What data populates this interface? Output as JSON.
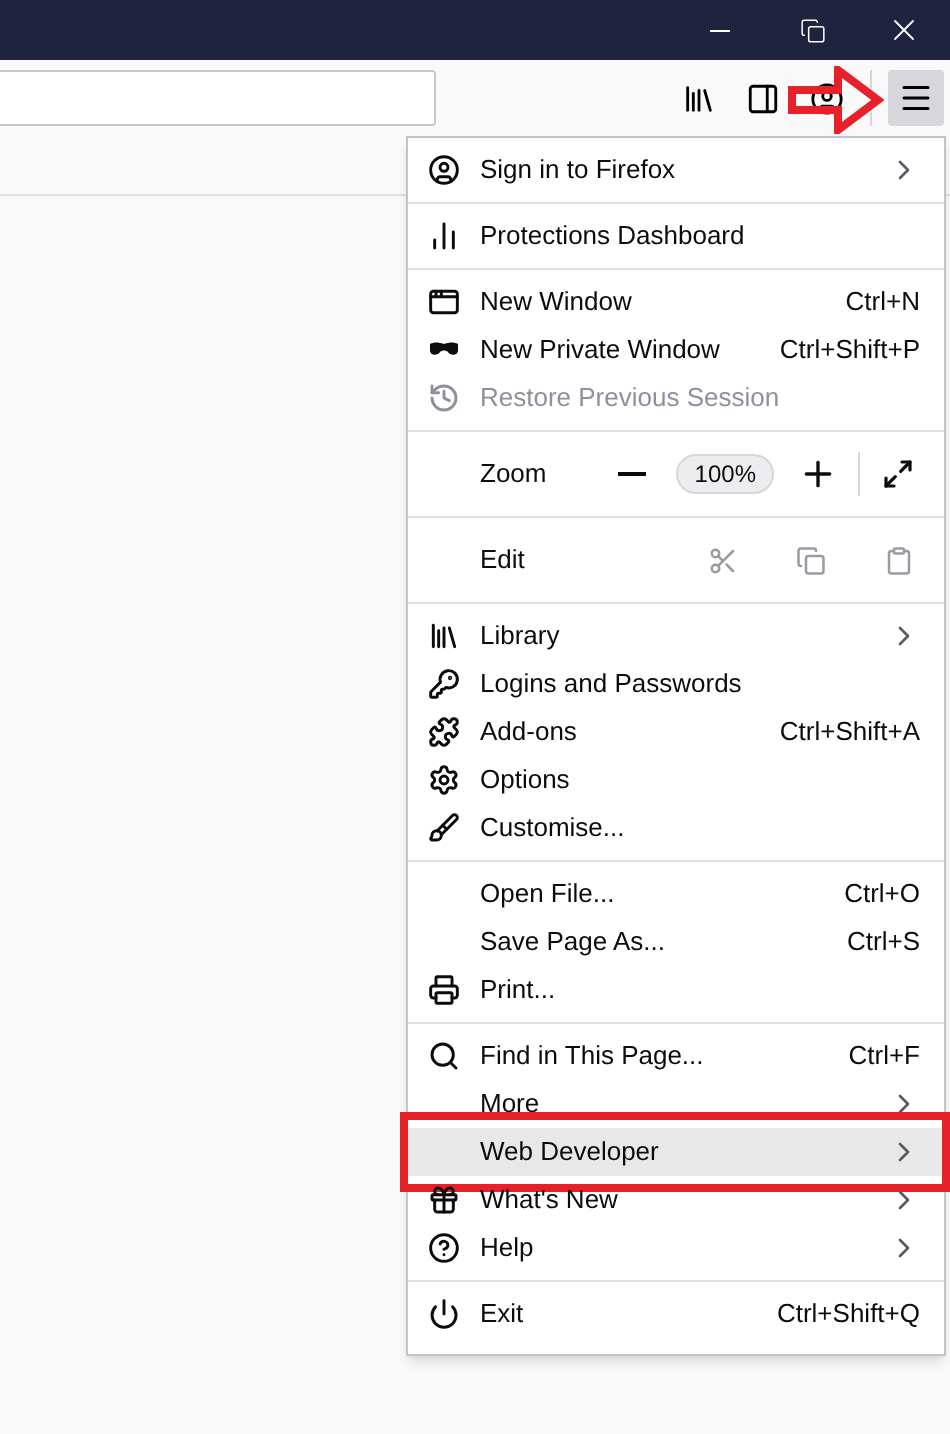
{
  "menu": {
    "sections": [
      {
        "items": [
          {
            "kind": "item",
            "label": "Sign in to Firefox",
            "submenu": true,
            "disabled": false,
            "selected": false
          }
        ]
      },
      {
        "items": [
          {
            "kind": "item",
            "label": "Protections Dashboard",
            "submenu": false,
            "disabled": false,
            "selected": false
          }
        ]
      },
      {
        "items": [
          {
            "kind": "item",
            "label": "New Window",
            "shortcut": "Ctrl+N",
            "submenu": false,
            "disabled": false,
            "selected": false
          },
          {
            "kind": "item",
            "label": "New Private Window",
            "shortcut": "Ctrl+Shift+P",
            "submenu": false,
            "disabled": false,
            "selected": false
          },
          {
            "kind": "item",
            "label": "Restore Previous Session",
            "submenu": false,
            "disabled": true,
            "selected": false
          }
        ]
      },
      {
        "items": [
          {
            "kind": "zoom",
            "label": "Zoom",
            "value": "100%"
          }
        ]
      },
      {
        "items": [
          {
            "kind": "edit",
            "label": "Edit",
            "tools_disabled": true
          }
        ]
      },
      {
        "items": [
          {
            "kind": "item",
            "label": "Library",
            "submenu": true,
            "disabled": false,
            "selected": false
          },
          {
            "kind": "item",
            "label": "Logins and Passwords",
            "submenu": false,
            "disabled": false,
            "selected": false
          },
          {
            "kind": "item",
            "label": "Add-ons",
            "shortcut": "Ctrl+Shift+A",
            "submenu": false,
            "disabled": false,
            "selected": false
          },
          {
            "kind": "item",
            "label": "Options",
            "submenu": false,
            "disabled": false,
            "selected": false
          },
          {
            "kind": "item",
            "label": "Customise...",
            "submenu": false,
            "disabled": false,
            "selected": false
          }
        ]
      },
      {
        "items": [
          {
            "kind": "item",
            "label": "Open File...",
            "shortcut": "Ctrl+O",
            "submenu": false,
            "disabled": false,
            "selected": false
          },
          {
            "kind": "item",
            "label": "Save Page As...",
            "shortcut": "Ctrl+S",
            "submenu": false,
            "disabled": false,
            "selected": false
          },
          {
            "kind": "item",
            "label": "Print...",
            "submenu": false,
            "disabled": false,
            "selected": false
          }
        ]
      },
      {
        "items": [
          {
            "kind": "item",
            "label": "Find in This Page...",
            "shortcut": "Ctrl+F",
            "submenu": false,
            "disabled": false,
            "selected": false
          },
          {
            "kind": "item",
            "label": "More",
            "submenu": true,
            "disabled": false,
            "selected": false
          },
          {
            "kind": "item",
            "label": "Web Developer",
            "submenu": true,
            "disabled": false,
            "selected": true
          },
          {
            "kind": "item",
            "label": "What's New",
            "submenu": true,
            "disabled": false,
            "selected": false
          },
          {
            "kind": "item",
            "label": "Help",
            "submenu": true,
            "disabled": false,
            "selected": false
          }
        ]
      },
      {
        "items": [
          {
            "kind": "item",
            "label": "Exit",
            "shortcut": "Ctrl+Shift+Q",
            "submenu": false,
            "disabled": false,
            "selected": false
          }
        ]
      }
    ]
  }
}
